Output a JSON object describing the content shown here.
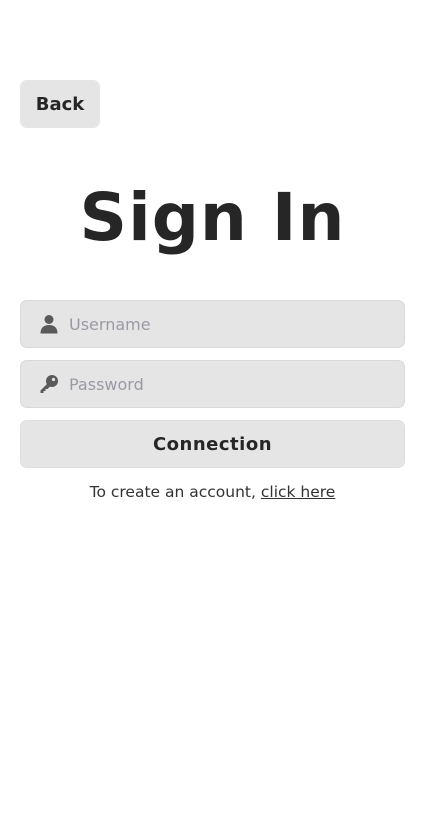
{
  "header": {
    "back_label": "Back"
  },
  "main": {
    "title": "Sign In"
  },
  "form": {
    "username": {
      "placeholder": "Username",
      "value": "",
      "icon": "user-icon"
    },
    "password": {
      "placeholder": "Password",
      "value": "",
      "icon": "key-icon"
    },
    "submit_label": "Connection"
  },
  "footer": {
    "signup_prefix": "To create an account, ",
    "signup_link": "click here"
  },
  "colors": {
    "background": "#ffffff",
    "surface": "#e5e5e5",
    "text": "#262626",
    "placeholder": "#9a9aa5",
    "icon": "#5a5a5a"
  }
}
